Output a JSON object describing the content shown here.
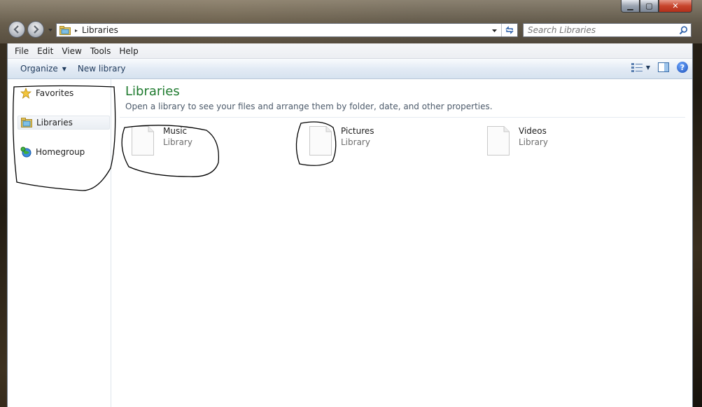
{
  "titlebar": {
    "minimize_glyph": "▁",
    "maximize_glyph": "▢",
    "close_glyph": "✕"
  },
  "address": {
    "breadcrumb_separator": "▸",
    "crumb": "Libraries"
  },
  "search": {
    "placeholder": "Search Libraries"
  },
  "menubar": {
    "items": [
      "File",
      "Edit",
      "View",
      "Tools",
      "Help"
    ]
  },
  "commandbar": {
    "organize": "Organize",
    "new_library": "New library",
    "help": "?"
  },
  "navpane": {
    "favorites": "Favorites",
    "libraries": "Libraries",
    "homegroup": "Homegroup"
  },
  "content": {
    "title": "Libraries",
    "description": "Open a library to see your files and arrange them by folder, date, and other properties.",
    "libraries": [
      {
        "name": "Music",
        "type": "Library"
      },
      {
        "name": "Pictures",
        "type": "Library"
      },
      {
        "name": "Videos",
        "type": "Library"
      }
    ]
  },
  "colors": {
    "title_green": "#1e7a2e",
    "annotation_ink": "#000000"
  }
}
